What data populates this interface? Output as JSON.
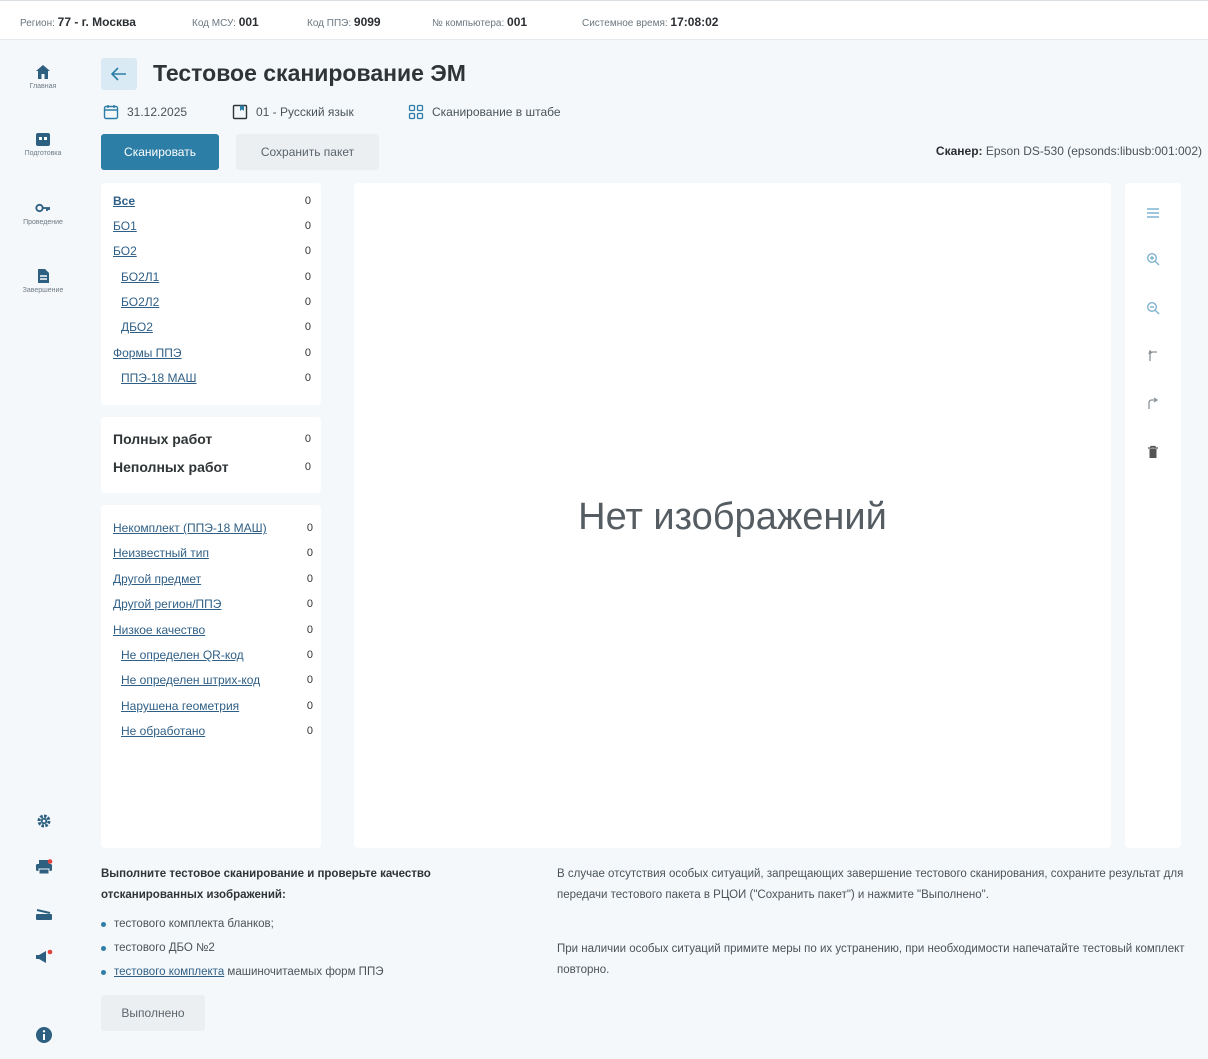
{
  "status_bar": {
    "region_label": "Регион:",
    "region_value": "77 - г. Москва",
    "msu_label": "Код МСУ:",
    "msu_value": "001",
    "ppe_label": "Код ППЭ:",
    "ppe_value": "9099",
    "computer_label": "№ компьютера:",
    "computer_value": "001",
    "time_label": "Системное время:",
    "time_value": "17:08:02"
  },
  "nav": {
    "items": [
      {
        "label": "Главная",
        "icon": "home-icon"
      },
      {
        "label": "Подготовка",
        "icon": "calendar-icon"
      },
      {
        "label": "Проведение",
        "icon": "key-icon"
      },
      {
        "label": "Завершение",
        "icon": "document-icon"
      }
    ],
    "bottom": [
      "gear-icon",
      "printer-icon",
      "scanner-icon",
      "megaphone-icon",
      "info-icon"
    ]
  },
  "header": {
    "title": "Тестовое сканирование ЭМ",
    "date": "31.12.2025",
    "subject": "01 - Русский язык",
    "mode": "Сканирование в штабе"
  },
  "actions": {
    "scan_label": "Сканировать",
    "save_label": "Сохранить пакет",
    "scanner_label": "Сканер:",
    "scanner_value": "Epson DS-530 (epsonds:libusb:001:002)"
  },
  "categories": [
    {
      "name": "Все",
      "count": "0"
    },
    {
      "name": "БО1",
      "count": "0"
    },
    {
      "name": "БО2",
      "count": "0"
    },
    {
      "name": "БО2Л1",
      "count": "0"
    },
    {
      "name": "БО2Л2",
      "count": "0"
    },
    {
      "name": "ДБО2",
      "count": "0"
    },
    {
      "name": "Формы ППЭ",
      "count": "0"
    },
    {
      "name": "ППЭ-18 МАШ",
      "count": "0"
    }
  ],
  "summary": [
    {
      "name": "Полных работ",
      "count": "0"
    },
    {
      "name": "Неполных работ",
      "count": "0"
    }
  ],
  "issues": [
    {
      "name": "Некомплект (ППЭ-18 МАШ)",
      "count": "0"
    },
    {
      "name": "Неизвестный тип",
      "count": "0"
    },
    {
      "name": "Другой предмет",
      "count": "0"
    },
    {
      "name": "Другой регион/ППЭ",
      "count": "0"
    },
    {
      "name": "Низкое качество",
      "count": "0"
    },
    {
      "name": "Не определен QR-код",
      "count": "0"
    },
    {
      "name": "Не определен штрих-код",
      "count": "0"
    },
    {
      "name": "Нарушена геометрия",
      "count": "0"
    },
    {
      "name": "Не обработано",
      "count": "0"
    }
  ],
  "viewer": {
    "empty_text": "Нет изображений",
    "tools": [
      "list-icon",
      "zoom-in-icon",
      "zoom-out-icon",
      "rotate-left-icon",
      "rotate-right-icon",
      "trash-icon"
    ]
  },
  "instructions": {
    "title": "Выполните тестовое сканирование и проверьте качество отсканированных изображений:",
    "bullet1": "тестового комплекта бланков;",
    "bullet2": "тестового ДБО №2",
    "bullet3_link": "тестового комплекта",
    "bullet3_rest": " машиночитаемых форм ППЭ",
    "para1": "В случае отсутствия особых ситуаций, запрещающих завершение тестового сканирования, сохраните результат для передачи тестового пакета в РЦОИ (\"Сохранить пакет\") и нажмите \"Выполнено\".",
    "para2": "При наличии особых ситуаций примите меры по их устранению, при необходимости напечатайте тестовый комплект повторно.",
    "done_label": "Выполнено"
  },
  "colors": {
    "accent": "#2d7ea6",
    "link": "#2f5f86",
    "background": "#f5f8fb"
  }
}
